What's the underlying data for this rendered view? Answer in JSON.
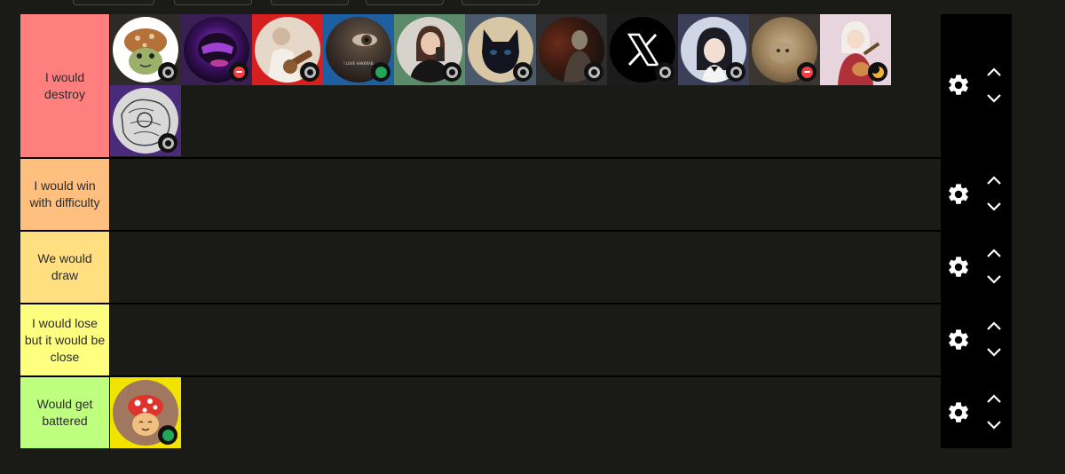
{
  "tiers": [
    {
      "label": "I would destroy",
      "color": "#ff7f7f"
    },
    {
      "label": "I would win with difficulty",
      "color": "#ffbf7f"
    },
    {
      "label": "We would draw",
      "color": "#ffdf7f"
    },
    {
      "label": "I would lose but it would be close",
      "color": "#ffff7f"
    },
    {
      "label": "Would get battered",
      "color": "#bfff7f"
    }
  ],
  "avatars": {
    "tier_1": [
      {
        "icon": "frog-mushroom-avatar",
        "status": "offline"
      },
      {
        "icon": "purple-helmet-avatar",
        "status": "dnd"
      },
      {
        "icon": "guitarist-photo-avatar",
        "status": "offline"
      },
      {
        "icon": "eye-closeup-avatar",
        "status": "online"
      },
      {
        "icon": "mirror-selfie-avatar",
        "status": "offline"
      },
      {
        "icon": "black-cat-avatar",
        "status": "offline"
      },
      {
        "icon": "dark-figure-avatar",
        "status": "offline"
      },
      {
        "icon": "x-logo-avatar",
        "status": "offline"
      },
      {
        "icon": "anime-girl-avatar",
        "status": "offline"
      },
      {
        "icon": "tan-cat-avatar",
        "status": "dnd"
      },
      {
        "icon": "anime-guitar-girl-avatar",
        "status": "idle"
      },
      {
        "icon": "sketch-drawing-avatar",
        "status": "offline"
      }
    ],
    "tier_5": [
      {
        "icon": "mushroom-character-avatar",
        "status": "online"
      }
    ]
  },
  "eye_avatar_caption": "I LOVE HAKKRAB"
}
